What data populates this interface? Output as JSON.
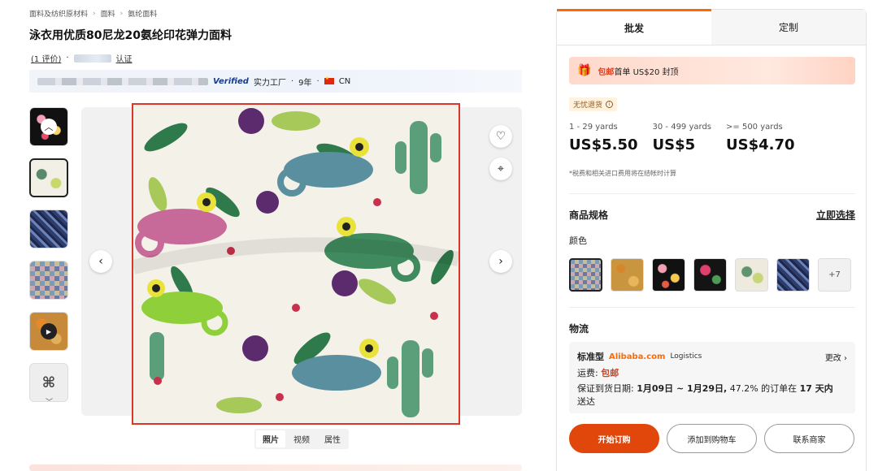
{
  "breadcrumb": [
    "面料及纺织原材料",
    "面料",
    "氨纶面料"
  ],
  "product": {
    "title": "泳衣用优质80尼龙20氨纶印花弹力面料",
    "reviews_link": "(1 评价)",
    "certified": "认证"
  },
  "supplier": {
    "verified": "Verified",
    "type": "实力工厂",
    "years": "9年",
    "country": "CN"
  },
  "media_tabs": [
    "照片",
    "视频",
    "属性"
  ],
  "panel": {
    "tabs": [
      "批发",
      "定制"
    ],
    "promo": {
      "prefix": "包邮",
      "text": "首单 US$20 封顶"
    },
    "no_return": "无忧退货",
    "tiers": [
      {
        "range": "1 - 29 yards",
        "price": "US$5.50"
      },
      {
        "range": "30 - 499 yards",
        "price": "US$5"
      },
      {
        "range": ">= 500 yards",
        "price": "US$4.70"
      }
    ],
    "tax_note": "*税费和相关进口费用将在结帐时计算",
    "spec_title": "商品规格",
    "select_now": "立即选择",
    "color_label": "颜色",
    "more_colors": "+7",
    "logistics": {
      "title": "物流",
      "type": "标准型",
      "brand": "Alibaba.com",
      "service": "Logistics",
      "change": "更改",
      "fee_label": "运费:",
      "fee_value": "包邮",
      "guarantee_label": "保证到货日期:",
      "date_range": "1月09日 ~ 1月29日,",
      "percent_text": "47.2% 的订单在",
      "days": "17 天内",
      "tail": "送达"
    },
    "buttons": {
      "order": "开始订购",
      "cart": "添加到购物车",
      "contact": "联系商家"
    }
  },
  "colors": {
    "accent": "#ff6a00",
    "primary_button": "#e1470b",
    "image_highlight": "#d9372b"
  }
}
